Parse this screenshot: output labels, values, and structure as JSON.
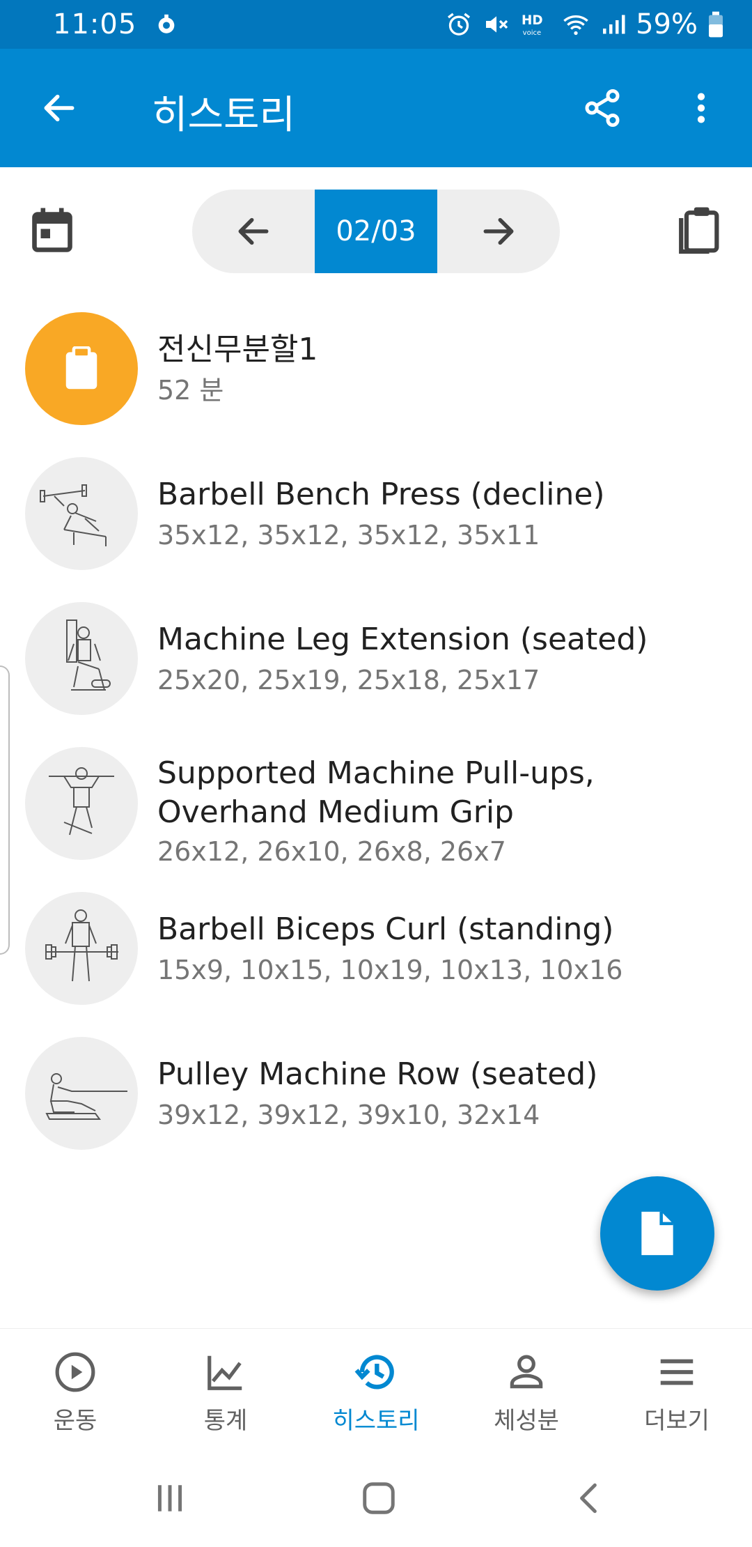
{
  "status_bar": {
    "time": "11:05",
    "battery": "59%"
  },
  "app_bar": {
    "title": "히스토리",
    "back_icon": "arrow-back-icon",
    "share_icon": "share-icon",
    "more_icon": "more-vert-icon"
  },
  "navigator": {
    "page": "02/03",
    "calendar_icon": "calendar-icon",
    "paste_icon": "clipboard-icon"
  },
  "workout": {
    "title": "전신무분할1",
    "duration": "52 분",
    "color": "#F9A825"
  },
  "exercises": [
    {
      "name": "Barbell Bench Press (decline)",
      "sets": "35x12, 35x12, 35x12, 35x11"
    },
    {
      "name": "Machine Leg Extension (seated)",
      "sets": "25x20, 25x19, 25x18, 25x17"
    },
    {
      "name_line1": "Supported Machine Pull-ups,",
      "name_line2": "Overhand Medium Grip",
      "sets": "26x12, 26x10, 26x8, 26x7"
    },
    {
      "name": "Barbell Biceps Curl (standing)",
      "sets": "15x9, 10x15, 10x19, 10x13, 10x16"
    },
    {
      "name": "Pulley Machine Row (seated)",
      "sets": "39x12, 39x12, 39x10, 32x14"
    }
  ],
  "bottom_nav": [
    {
      "label": "운동",
      "icon": "play-circle-icon",
      "active": false
    },
    {
      "label": "통계",
      "icon": "chart-line-icon",
      "active": false
    },
    {
      "label": "히스토리",
      "icon": "history-icon",
      "active": true
    },
    {
      "label": "체성분",
      "icon": "person-icon",
      "active": false
    },
    {
      "label": "더보기",
      "icon": "menu-icon",
      "active": false
    }
  ],
  "colors": {
    "primary": "#0288D1",
    "status_bar": "#0277BD",
    "accent": "#F9A825"
  }
}
